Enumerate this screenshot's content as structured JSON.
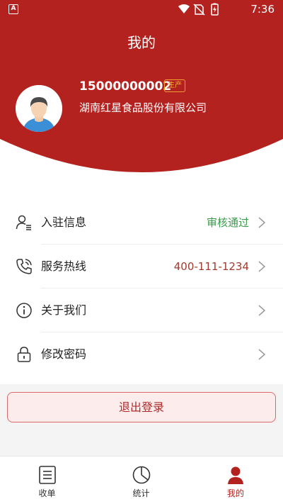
{
  "colors": {
    "brand_red": "#b3221f",
    "approved_green": "#3a9a4a",
    "hotline_red": "#a23a2e",
    "badge_orange": "#f0a030",
    "chevron_gray": "#9a9a9a"
  },
  "status_bar": {
    "app_indicator": "A",
    "time": "7:36",
    "icons": [
      "wifi-icon",
      "no-sim-icon",
      "battery-charging-icon"
    ]
  },
  "header": {
    "title": "我的"
  },
  "profile": {
    "avatar_icon": "user-avatar-icon",
    "phone": "15000000002",
    "role_badge": "生产",
    "company": "湖南红星食品股份有限公司"
  },
  "menu": {
    "items": [
      {
        "icon": "user-list-icon",
        "label": "入驻信息",
        "value": "审核通过",
        "value_color": "#3a9a4a"
      },
      {
        "icon": "phone-icon",
        "label": "服务热线",
        "value": "400-111-1234",
        "value_color": "#a23a2e"
      },
      {
        "icon": "info-icon",
        "label": "关于我们",
        "value": "",
        "value_color": ""
      },
      {
        "icon": "lock-icon",
        "label": "修改密码",
        "value": "",
        "value_color": ""
      }
    ]
  },
  "logout": {
    "label": "退出登录"
  },
  "tabbar": {
    "active_index": 2,
    "tabs": [
      {
        "icon": "receipt-icon",
        "label": "收单"
      },
      {
        "icon": "pie-chart-icon",
        "label": "统计"
      },
      {
        "icon": "person-icon",
        "label": "我的"
      }
    ]
  }
}
